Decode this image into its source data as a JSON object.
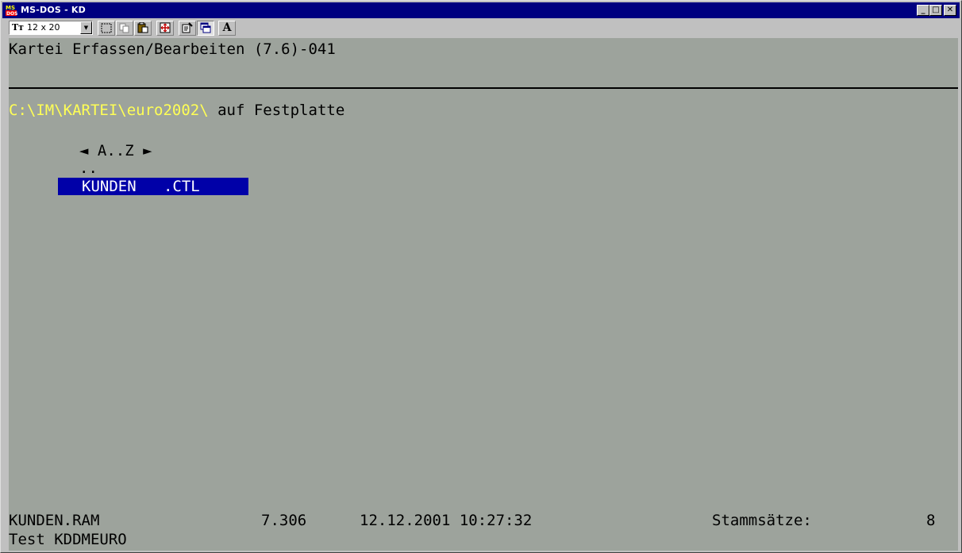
{
  "window": {
    "title": "MS-DOS - KD",
    "buttons": {
      "minimize": "_",
      "maximize": "□",
      "close": "✕"
    }
  },
  "toolbar": {
    "font_size_value": "12 x 20",
    "font_icon": "Tт",
    "buttons": [
      "mark-icon",
      "copy-icon",
      "paste-icon",
      "fullscreen-icon",
      "properties-icon",
      "background-icon",
      "font-icon"
    ],
    "font_button_label": "A"
  },
  "console": {
    "header": "Kartei Erfassen/Bearbeiten (7.6)-041",
    "path": "C:\\IM\\KARTEI\\euro2002\\",
    "path_suffix": " auf Festplatte",
    "sort_label": "◄ A..Z ►",
    "parent_dir": "..",
    "files": [
      {
        "name": "KUNDEN   .CTL",
        "selected": true
      }
    ],
    "status": {
      "filename": "KUNDEN.RAM",
      "version": "7.306",
      "datetime": "12.12.2001 10:27:32",
      "records_label": "Stammsätze:",
      "records_count": "8",
      "comment": "Test KDDMEURO"
    }
  },
  "colors": {
    "console_bg": "#9da39c",
    "path_yellow": "#ffff55",
    "selection_bg": "#0000a8",
    "titlebar": "#000080"
  }
}
